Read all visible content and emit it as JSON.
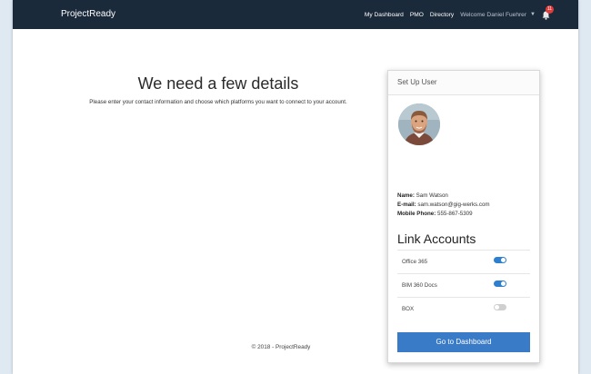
{
  "navbar": {
    "brand": "ProjectReady",
    "links": [
      "My Dashboard",
      "PMO",
      "Directory"
    ],
    "welcome": "Welcome Daniel Fuehrer",
    "notification_count": "11",
    "bg_color": "#1b2a3b"
  },
  "main": {
    "heading": "We need a few details",
    "subtext": "Please enter your contact information and choose which platforms you want to connect to your account.",
    "footer": "© 2018 - ProjectReady"
  },
  "setup_card": {
    "title": "Set Up User",
    "name_label": "Name:",
    "name_value": "Sam Watson",
    "email_label": "E-mail:",
    "email_value": "sam.watson@gig-werks.com",
    "phone_label": "Mobile Phone:",
    "phone_value": "555-867-5309",
    "link_title": "Link Accounts",
    "accounts": [
      {
        "label": "Office 365",
        "enabled": true
      },
      {
        "label": "BIM 360 Docs",
        "enabled": true
      },
      {
        "label": "BOX",
        "enabled": false
      }
    ],
    "button_label": "Go to Dashboard",
    "accent_color": "#3a7bc8"
  }
}
